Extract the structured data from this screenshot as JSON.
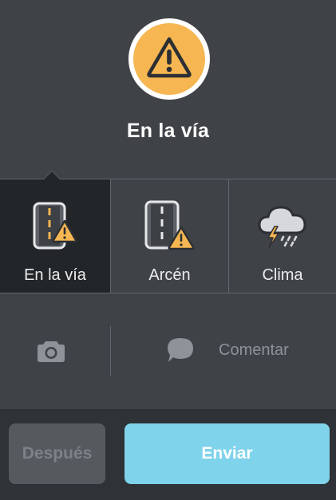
{
  "header": {
    "icon": "hazard-warning-icon",
    "title": "En la vía"
  },
  "tabs": [
    {
      "label": "En la vía",
      "icon": "road-hazard-icon",
      "selected": true
    },
    {
      "label": "Arcén",
      "icon": "shoulder-hazard-icon",
      "selected": false
    },
    {
      "label": "Clima",
      "icon": "storm-cloud-icon",
      "selected": false
    }
  ],
  "actions": {
    "camera_icon": "camera-icon",
    "comment_icon": "comment-icon",
    "comment_label": "Comentar"
  },
  "footer": {
    "later_label": "Después",
    "send_label": "Enviar"
  },
  "colors": {
    "background": "#3f4348",
    "selected_tab": "#232629",
    "hazard_yellow": "#f6b651",
    "send_button": "#7fd3ea",
    "later_button": "#56595e"
  }
}
